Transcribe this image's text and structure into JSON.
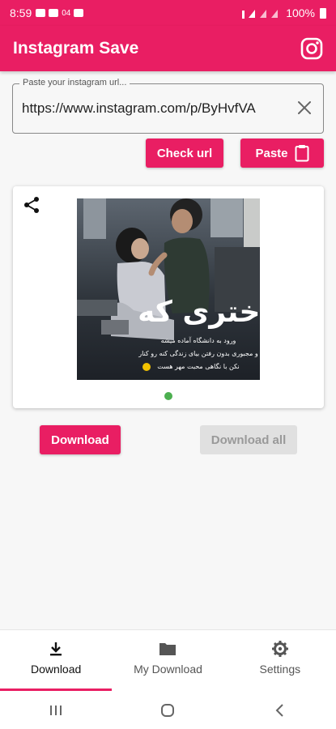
{
  "status_bar": {
    "time": "8:59",
    "battery": "100%",
    "network_badge": "04"
  },
  "app_bar": {
    "title": "Instagram Save",
    "icon": "instagram-icon"
  },
  "url_input": {
    "label": "Paste your instagram url...",
    "value": "https://www.instagram.com/p/ByHvfVA"
  },
  "actions": {
    "check_url": "Check url",
    "paste": "Paste"
  },
  "preview": {
    "overlay_text_main": "دختری که",
    "overlay_lines": [
      "ورود به دانشگاه آماده میشه",
      "و مجبوری بدون رفتن بیای زندگی کنه رو کنار",
      "نکن با نگاهی محبت مهر هست"
    ],
    "carousel_index": 1
  },
  "buttons": {
    "download": "Download",
    "download_all": "Download all"
  },
  "bottom_nav": [
    {
      "label": "Download",
      "icon": "download-icon",
      "active": true
    },
    {
      "label": "My Download",
      "icon": "folder-icon",
      "active": false
    },
    {
      "label": "Settings",
      "icon": "gear-icon",
      "active": false
    }
  ],
  "colors": {
    "primary": "#e91e63",
    "indicator": "#4caf50",
    "disabled": "#e0e0e0"
  }
}
